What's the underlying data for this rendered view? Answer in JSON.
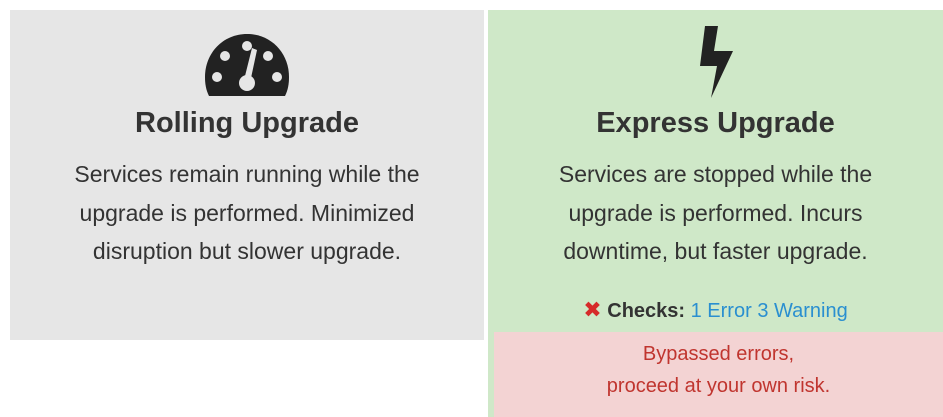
{
  "options": {
    "rolling": {
      "icon": "dashboard-gauge-icon",
      "title": "Rolling Upgrade",
      "description_line1": "Services remain running while the",
      "description_line2": "upgrade is performed. Minimized",
      "description_line3": "disruption but slower upgrade.",
      "background": "#e6e6e6"
    },
    "express": {
      "icon": "lightning-bolt-icon",
      "title": "Express Upgrade",
      "description_line1": "Services are stopped while the",
      "description_line2": "upgrade is performed. Incurs",
      "description_line3": "downtime, but faster upgrade.",
      "background": "#cfe8c8",
      "checks": {
        "status_icon": "error-x-icon",
        "label": "Checks:",
        "errors_link": "1 Error",
        "warnings_link": "3 Warning"
      },
      "alert": {
        "line1": "Bypassed errors,",
        "line2": "proceed at your own risk.",
        "background": "#f3d3d3",
        "text_color": "#c0352f"
      }
    }
  }
}
